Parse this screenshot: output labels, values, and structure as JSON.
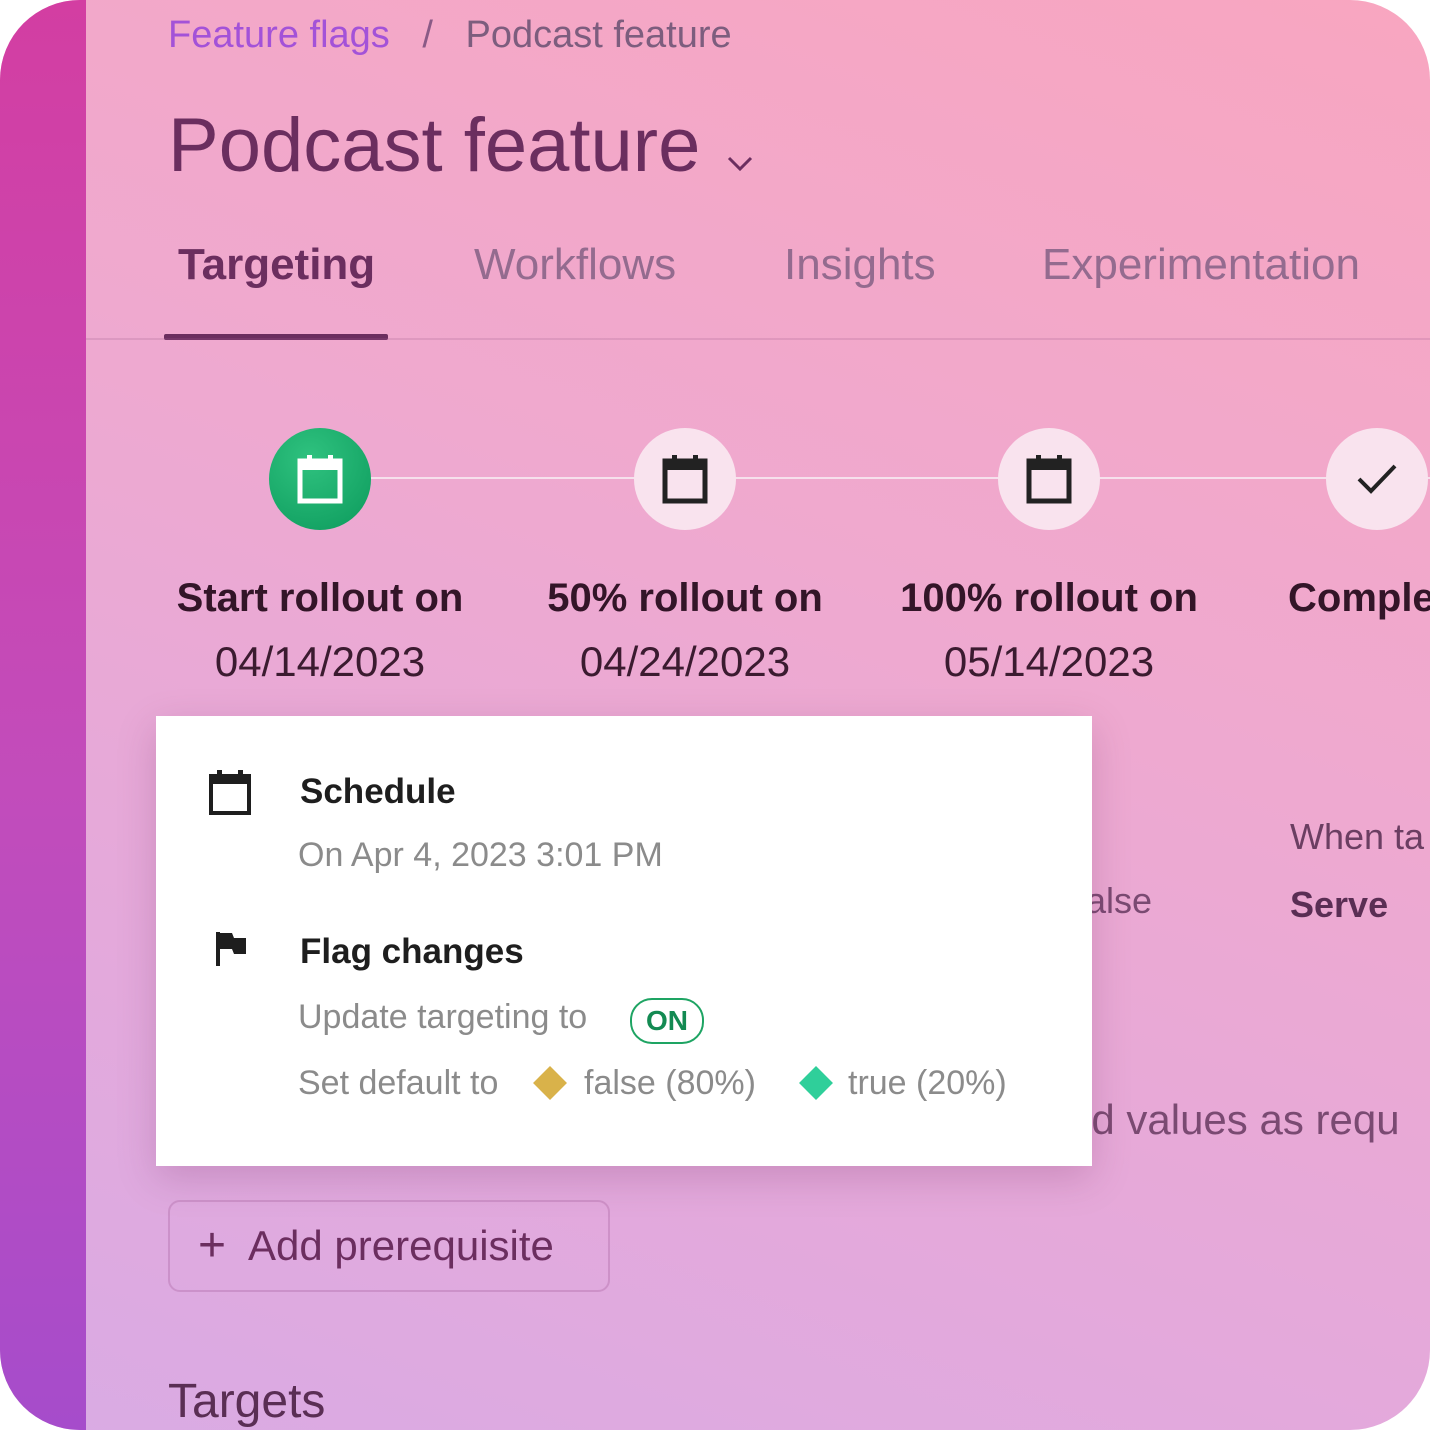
{
  "breadcrumb": {
    "link": "Feature flags",
    "separator": "/",
    "current": "Podcast feature"
  },
  "page_title": "Podcast feature",
  "tabs": [
    {
      "label": "Targeting",
      "active": true
    },
    {
      "label": "Workflows",
      "active": false
    },
    {
      "label": "Insights",
      "active": false
    },
    {
      "label": "Experimentation",
      "active": false
    }
  ],
  "timeline": [
    {
      "label": "Start rollout on",
      "date": "04/14/2023",
      "icon": "calendar-icon",
      "state": "current"
    },
    {
      "label": "50% rollout on",
      "date": "04/24/2023",
      "icon": "calendar-icon",
      "state": "upcoming"
    },
    {
      "label": "100% rollout on",
      "date": "05/14/2023",
      "icon": "calendar-icon",
      "state": "upcoming"
    },
    {
      "label": "Comple",
      "date": "",
      "icon": "check-icon",
      "state": "upcoming"
    }
  ],
  "background": {
    "when_text": "When ta",
    "serve_text": "Serve",
    "false_text": "false",
    "values_text": "ed values as requ"
  },
  "popover": {
    "schedule_title": "Schedule",
    "schedule_value": "On Apr 4, 2023  3:01 PM",
    "flag_changes_title": "Flag changes",
    "update_text": "Update targeting to",
    "on_badge": "ON",
    "set_default_text": "Set default to",
    "variation_false": "false (80%)",
    "variation_true": "true (20%)"
  },
  "add_prerequisite": "Add prerequisite",
  "targets_heading": "Targets",
  "colors": {
    "accent": "#6b2e5f",
    "link": "#a352d8",
    "success": "#1ea463",
    "variation_false": "#d9b24a",
    "variation_true": "#2fcf9a"
  }
}
